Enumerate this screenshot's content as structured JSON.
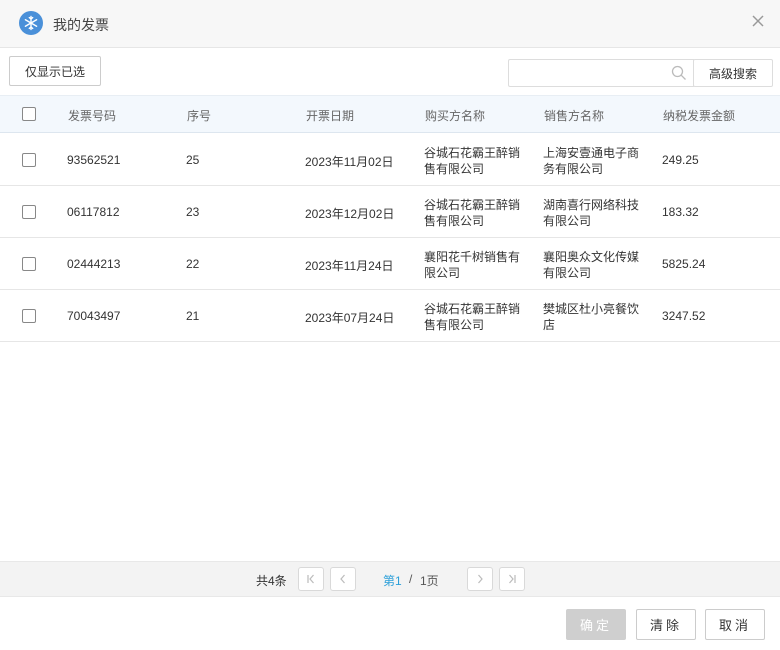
{
  "dialog": {
    "title": "我的发票"
  },
  "toolbar": {
    "filter_selected_label": "仅显示已选",
    "search_value": "",
    "search_placeholder": "",
    "advanced_search_label": "高级搜索"
  },
  "table": {
    "headers": {
      "invoice_no": "发票号码",
      "seq": "序号",
      "date": "开票日期",
      "buyer": "购买方名称",
      "seller": "销售方名称",
      "amount": "纳税发票金额"
    },
    "rows": [
      {
        "invoice_no": "93562521",
        "seq": "25",
        "date": "2023年11月02日",
        "buyer": "谷城石花霸王醉销售有限公司",
        "seller": "上海安壹通电子商务有限公司",
        "amount": "249.25"
      },
      {
        "invoice_no": "06117812",
        "seq": "23",
        "date": "2023年12月02日",
        "buyer": "谷城石花霸王醉销售有限公司",
        "seller": "湖南喜行网络科技有限公司",
        "amount": "183.32"
      },
      {
        "invoice_no": "02444213",
        "seq": "22",
        "date": "2023年11月24日",
        "buyer": "襄阳花千树销售有限公司",
        "seller": "襄阳奥众文化传媒有限公司",
        "amount": "5825.24"
      },
      {
        "invoice_no": "70043497",
        "seq": "21",
        "date": "2023年07月24日",
        "buyer": "谷城石花霸王醉销售有限公司",
        "seller": "樊城区杜小亮餐饮店",
        "amount": "3247.52"
      }
    ]
  },
  "pager": {
    "total_text": "共4条",
    "current_page": "第1",
    "separator": "/",
    "total_pages": "1页"
  },
  "footer": {
    "ok_label": "确定",
    "clear_label": "清除",
    "cancel_label": "取消"
  },
  "colors": {
    "accent": "#2b9fd9",
    "header_bg": "#f3f8fd",
    "disabled_btn": "#cfcfcf",
    "app_icon": "#4a90d9"
  }
}
